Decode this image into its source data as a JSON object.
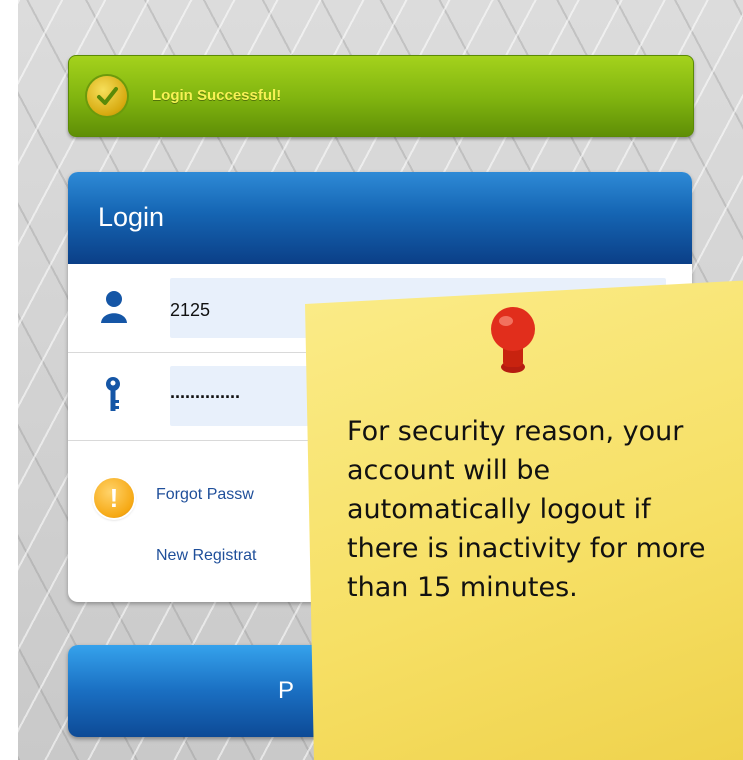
{
  "alert": {
    "message": "Login Successful!"
  },
  "login": {
    "title": "Login",
    "username_value": "2125",
    "password_value": "..............",
    "forgot_label": "Forgot Passw",
    "register_label": "New Registrat"
  },
  "proceed_button": {
    "label": "P"
  },
  "note": {
    "text": "For security reason, your account will be automatically logout if there is inactivity for more than 15 minutes."
  },
  "icons": {
    "alert_icon": "check-circle-icon",
    "user_icon": "user-icon",
    "password_icon": "key-icon",
    "warning_icon": "exclamation-circle-icon",
    "pin_icon": "push-pin-icon"
  },
  "colors": {
    "success": "#7fb30f",
    "header": "#1565b3",
    "note": "#f6df64",
    "pin": "#e12e1c"
  }
}
